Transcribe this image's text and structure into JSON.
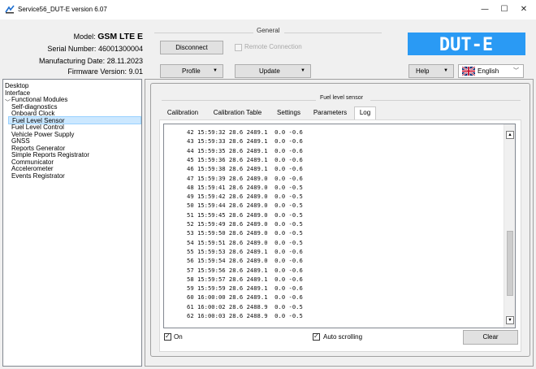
{
  "window": {
    "title": "Service56_DUT-E version 6.07",
    "minimize": "—",
    "maximize": "☐",
    "close": "✕"
  },
  "device": {
    "model_label": "Model:",
    "model_value": "GSM LTE E",
    "serial_label": "Serial Number:",
    "serial_value": "46001300004",
    "mfg_label": "Manufacturing Date:",
    "mfg_value": "28.11.2023",
    "fw_label": "Firmware Version:",
    "fw_value": "9.01"
  },
  "general": {
    "label": "General",
    "disconnect": "Disconnect",
    "remote_connection": "Remote Connection",
    "profile": "Profile",
    "update": "Update",
    "help": "Help",
    "language": "English",
    "logo": "DUT-E",
    "logo_color": "#2a9af4"
  },
  "tree": {
    "items": [
      {
        "label": "Desktop",
        "level": 0
      },
      {
        "label": "Interface",
        "level": 0
      },
      {
        "label": "Functional Modules",
        "level": 0,
        "expanded": true
      },
      {
        "label": "Self-diagnostics",
        "level": 1
      },
      {
        "label": "Onboard Clock",
        "level": 1
      },
      {
        "label": "Fuel Level Sensor",
        "level": 1,
        "selected": true
      },
      {
        "label": "Fuel Level Control",
        "level": 1
      },
      {
        "label": "Vehicle Power Supply",
        "level": 1
      },
      {
        "label": "GNSS",
        "level": 1
      },
      {
        "label": "Reports Generator",
        "level": 1
      },
      {
        "label": "Simple Reports Registrator",
        "level": 1
      },
      {
        "label": "Communicator",
        "level": 1
      },
      {
        "label": "Accelerometer",
        "level": 1
      },
      {
        "label": "Events Registrator",
        "level": 1
      }
    ]
  },
  "panel": {
    "title": "Fuel level sensor",
    "tabs": [
      {
        "label": "Calibration"
      },
      {
        "label": "Calibration Table"
      },
      {
        "label": "Settings"
      },
      {
        "label": "Parameters"
      },
      {
        "label": "Log",
        "active": true
      }
    ],
    "log_lines": [
      "42 15:59:32 28.6 2489.1  0.0 -0.6",
      "43 15:59:33 28.6 2489.1  0.0 -0.6",
      "44 15:59:35 28.6 2489.1  0.0 -0.6",
      "45 15:59:36 28.6 2489.1  0.0 -0.6",
      "46 15:59:38 28.6 2489.1  0.0 -0.6",
      "47 15:59:39 28.6 2489.0  0.0 -0.6",
      "48 15:59:41 28.6 2489.0  0.0 -0.5",
      "49 15:59:42 28.6 2489.0  0.0 -0.5",
      "50 15:59:44 28.6 2489.0  0.0 -0.5",
      "51 15:59:45 28.6 2489.0  0.0 -0.5",
      "52 15:59:49 28.6 2489.0  0.0 -0.5",
      "53 15:59:50 28.6 2489.0  0.0 -0.5",
      "54 15:59:51 28.6 2489.0  0.0 -0.5",
      "55 15:59:53 28.6 2489.1  0.0 -0.6",
      "56 15:59:54 28.6 2489.0  0.0 -0.6",
      "57 15:59:56 28.6 2489.1  0.0 -0.6",
      "58 15:59:57 28.6 2489.1  0.0 -0.6",
      "59 15:59:59 28.6 2489.1  0.0 -0.6",
      "60 16:00:00 28.6 2489.1  0.0 -0.6",
      "61 16:00:02 28.6 2488.9  0.0 -0.5",
      "62 16:00:03 28.6 2488.9  0.0 -0.5"
    ],
    "scroll_position": 0.83,
    "on_label": "On",
    "on_checked": true,
    "autoscroll_label": "Auto scrolling",
    "autoscroll_checked": true,
    "clear": "Clear"
  }
}
